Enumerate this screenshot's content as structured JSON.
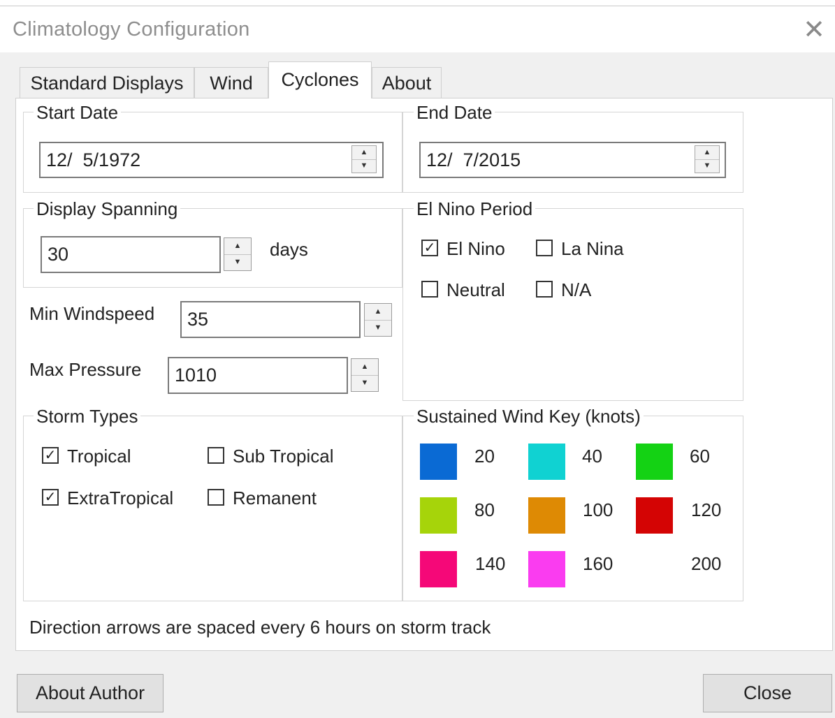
{
  "window": {
    "title": "Climatology Configuration"
  },
  "tabs": [
    {
      "label": "Standard Displays",
      "active": false
    },
    {
      "label": "Wind",
      "active": false
    },
    {
      "label": "Cyclones",
      "active": true
    },
    {
      "label": "About",
      "active": false
    }
  ],
  "start_date": {
    "legend": "Start Date",
    "value": "12/  5/1972"
  },
  "end_date": {
    "legend": "End Date",
    "value": "12/  7/2015"
  },
  "display_spanning": {
    "legend": "Display Spanning",
    "value": "30",
    "unit": "days"
  },
  "min_windspeed": {
    "label": "Min Windspeed",
    "value": "35"
  },
  "max_pressure": {
    "label": "Max Pressure",
    "value": "1010"
  },
  "el_nino_period": {
    "legend": "El Nino Period",
    "options": [
      {
        "label": "El Nino",
        "checked": true
      },
      {
        "label": "La Nina",
        "checked": false
      },
      {
        "label": "Neutral",
        "checked": false
      },
      {
        "label": "N/A",
        "checked": false
      }
    ]
  },
  "storm_types": {
    "legend": "Storm Types",
    "options": [
      {
        "label": "Tropical",
        "checked": true
      },
      {
        "label": "Sub Tropical",
        "checked": false
      },
      {
        "label": "ExtraTropical",
        "checked": true
      },
      {
        "label": "Remanent",
        "checked": false
      }
    ]
  },
  "wind_key": {
    "legend": "Sustained Wind Key (knots)",
    "entries": [
      {
        "value": "20",
        "color": "#0a6ad4"
      },
      {
        "value": "40",
        "color": "#10d2d2"
      },
      {
        "value": "60",
        "color": "#14d214"
      },
      {
        "value": "80",
        "color": "#a6d40a"
      },
      {
        "value": "100",
        "color": "#de8a04"
      },
      {
        "value": "120",
        "color": "#d40404"
      },
      {
        "value": "140",
        "color": "#f50878"
      },
      {
        "value": "160",
        "color": "#fa3cf0"
      },
      {
        "value": "200",
        "color": ""
      }
    ]
  },
  "note": "Direction arrows are spaced every 6 hours on storm track",
  "buttons": {
    "about_author": "About Author",
    "close": "Close"
  },
  "icons": {
    "close": "close-icon",
    "spin_up": "up-arrow-icon",
    "spin_down": "down-arrow-icon",
    "check": "checkmark-icon"
  }
}
